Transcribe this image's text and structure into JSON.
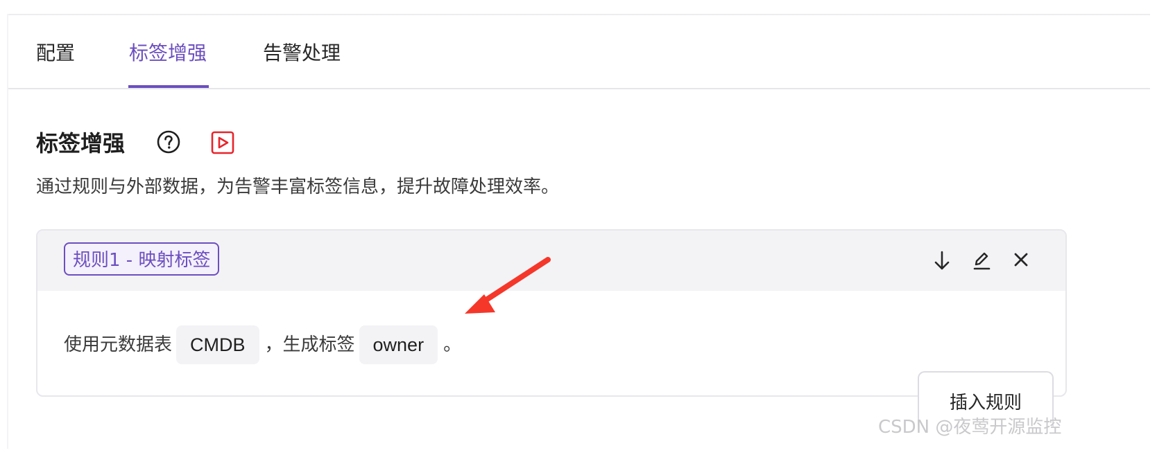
{
  "tabs": [
    {
      "label": "配置",
      "active": false
    },
    {
      "label": "标签增强",
      "active": true
    },
    {
      "label": "告警处理",
      "active": false
    }
  ],
  "section": {
    "title": "标签增强",
    "description": "通过规则与外部数据，为告警丰富标签信息，提升故障处理效率。",
    "help_icon": "question-circle-icon",
    "video_icon": "play-video-icon"
  },
  "rule": {
    "tag": "规则1 - 映射标签",
    "actions": [
      "arrow-down-icon",
      "edit-pencil-icon",
      "close-icon"
    ],
    "text_prefix": "使用元数据表",
    "table_name": "CMDB",
    "text_middle": "，生成标签",
    "label_name": "owner",
    "text_suffix": "。"
  },
  "insert_button": {
    "label": "插入规则"
  },
  "watermark": "CSDN @夜莺开源监控",
  "colors": {
    "accent": "#6b4ebf",
    "annotation_arrow": "#f5372a",
    "video_icon": "#e8232a"
  }
}
